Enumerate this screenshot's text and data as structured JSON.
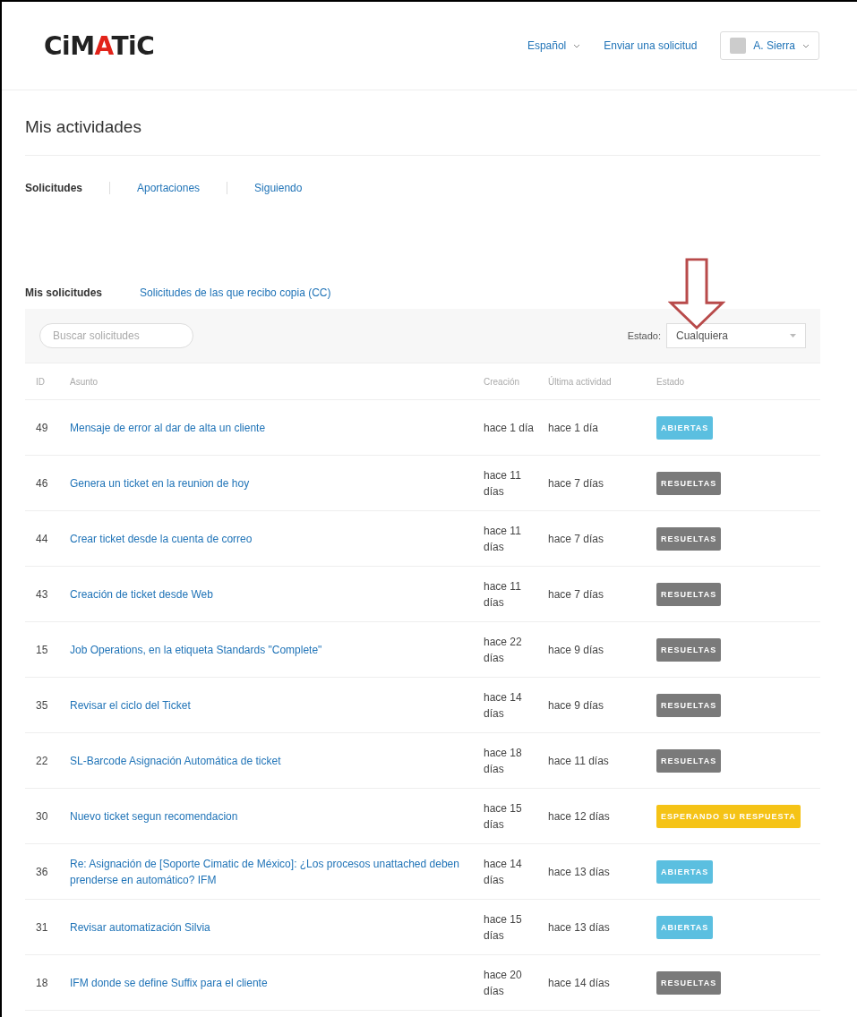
{
  "header": {
    "logo": [
      "CiM",
      "A",
      "TiC"
    ],
    "language": "Español",
    "submit_link": "Enviar una solicitud",
    "user": "A. Sierra"
  },
  "title": "Mis actividades",
  "tabs": [
    {
      "label": "Solicitudes",
      "selected": true
    },
    {
      "label": "Aportaciones",
      "selected": false
    },
    {
      "label": "Siguiendo",
      "selected": false
    }
  ],
  "subtabs": [
    {
      "label": "Mis solicitudes",
      "selected": true
    },
    {
      "label": "Solicitudes de las que recibo copia (CC)",
      "selected": false
    }
  ],
  "search": {
    "placeholder": "Buscar solicitudes"
  },
  "status_filter": {
    "label": "Estado:",
    "value": "Cualquiera"
  },
  "table": {
    "columns": [
      "ID",
      "Asunto",
      "Creación",
      "Última actividad",
      "Estado"
    ],
    "rows": [
      {
        "id": "49",
        "subject": "Mensaje de error al dar de alta un cliente",
        "created": "hace 1 día",
        "updated": "hace 1 día",
        "status": "ABIERTAS",
        "kind": "open"
      },
      {
        "id": "46",
        "subject": "Genera un ticket en la reunion de hoy",
        "created": "hace 11 días",
        "updated": "hace 7 días",
        "status": "RESUELTAS",
        "kind": "solved"
      },
      {
        "id": "44",
        "subject": "Crear ticket desde la cuenta de correo",
        "created": "hace 11 días",
        "updated": "hace 7 días",
        "status": "RESUELTAS",
        "kind": "solved"
      },
      {
        "id": "43",
        "subject": "Creación de ticket desde Web",
        "created": "hace 11 días",
        "updated": "hace 7 días",
        "status": "RESUELTAS",
        "kind": "solved"
      },
      {
        "id": "15",
        "subject": "Job Operations, en la etiqueta Standards \"Complete\"",
        "created": "hace 22 días",
        "updated": "hace 9 días",
        "status": "RESUELTAS",
        "kind": "solved"
      },
      {
        "id": "35",
        "subject": "Revisar el ciclo del Ticket",
        "created": "hace 14 días",
        "updated": "hace 9 días",
        "status": "RESUELTAS",
        "kind": "solved"
      },
      {
        "id": "22",
        "subject": "SL-Barcode Asignación Automática de ticket",
        "created": "hace 18 días",
        "updated": "hace 11 días",
        "status": "RESUELTAS",
        "kind": "solved"
      },
      {
        "id": "30",
        "subject": "Nuevo ticket segun recomendacion",
        "created": "hace 15 días",
        "updated": "hace 12 días",
        "status": "ESPERANDO SU RESPUESTA",
        "kind": "pending"
      },
      {
        "id": "36",
        "subject": "Re: Asignación de [Soporte Cimatic de México]: ¿Los procesos unattached deben prenderse en automático? IFM",
        "created": "hace 14 días",
        "updated": "hace 13 días",
        "status": "ABIERTAS",
        "kind": "open"
      },
      {
        "id": "31",
        "subject": "Revisar automatización Silvia",
        "created": "hace 15 días",
        "updated": "hace 13 días",
        "status": "ABIERTAS",
        "kind": "open"
      },
      {
        "id": "18",
        "subject": "IFM donde se define Suffix para el cliente",
        "created": "hace 20 días",
        "updated": "hace 14 días",
        "status": "RESUELTAS",
        "kind": "solved"
      }
    ]
  }
}
